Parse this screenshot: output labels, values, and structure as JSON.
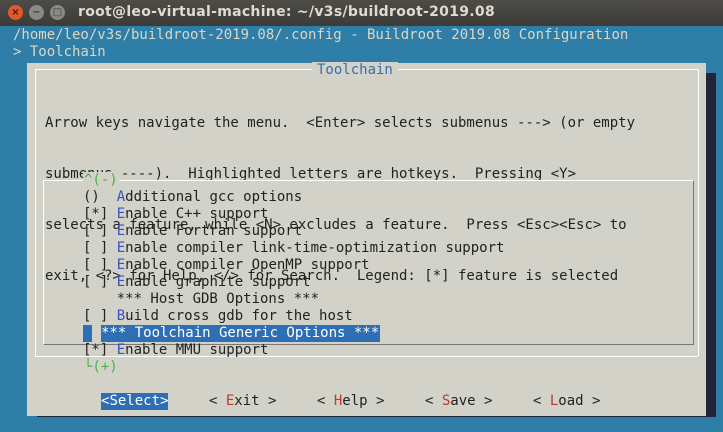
{
  "window": {
    "title": "root@leo-virtual-machine: ~/v3s/buildroot-2019.08"
  },
  "header": {
    "line1": "/home/leo/v3s/buildroot-2019.08/.config - Buildroot 2019.08 Configuration",
    "line2": "> Toolchain"
  },
  "dialog": {
    "title": "Toolchain",
    "help": [
      "Arrow keys navigate the menu.  <Enter> selects submenus ---> (or empty",
      "submenus ----).  Highlighted letters are hotkeys.  Pressing <Y>",
      "selects a feature, while <N> excludes a feature.  Press <Esc><Esc> to",
      "exit, <?> for Help, </> for Search.  Legend: [*] feature is selected"
    ],
    "scroll_up": "^(-)",
    "scroll_down": "└(+)",
    "items": [
      {
        "prefix": "()  ",
        "hot": "A",
        "rest": "dditional gcc options"
      },
      {
        "prefix": "[*] ",
        "hot": "E",
        "rest": "nable C++ support"
      },
      {
        "prefix": "[ ] ",
        "hot": "E",
        "rest": "nable Fortran support"
      },
      {
        "prefix": "[ ] ",
        "hot": "E",
        "rest": "nable compiler link-time-optimization support"
      },
      {
        "prefix": "[ ] ",
        "hot": "E",
        "rest": "nable compiler OpenMP support"
      },
      {
        "prefix": "[ ] ",
        "hot": "E",
        "rest": "nable graphite support"
      },
      {
        "prefix": "    ",
        "hot": "",
        "rest": "*** Host GDB Options ***"
      },
      {
        "prefix": "[ ] ",
        "hot": "B",
        "rest": "uild cross gdb for the host"
      },
      {
        "prefix": "    ",
        "hot": "",
        "rest": "*** Toolchain Generic Options ***"
      },
      {
        "prefix": "[*] ",
        "hot": "E",
        "rest": "nable MMU support"
      }
    ],
    "buttons": [
      {
        "open": "<",
        "hot": "S",
        "rest": "elect",
        "close": ">"
      },
      {
        "open": "< ",
        "hot": "E",
        "rest": "xit",
        "close": " >"
      },
      {
        "open": "< ",
        "hot": "H",
        "rest": "elp",
        "close": " >"
      },
      {
        "open": "< ",
        "hot": "S",
        "rest": "ave",
        "close": " >"
      },
      {
        "open": "< ",
        "hot": "L",
        "rest": "oad",
        "close": " >"
      }
    ]
  },
  "colors": {
    "terminal_bg": "#2f7ea8",
    "dialog_bg": "#d2d2c9",
    "selection": "#2e6eb5",
    "hotkey_menu": "#3b4fb8",
    "hotkey_button": "#c0392b",
    "scroll_arrow": "#4bb04b"
  }
}
